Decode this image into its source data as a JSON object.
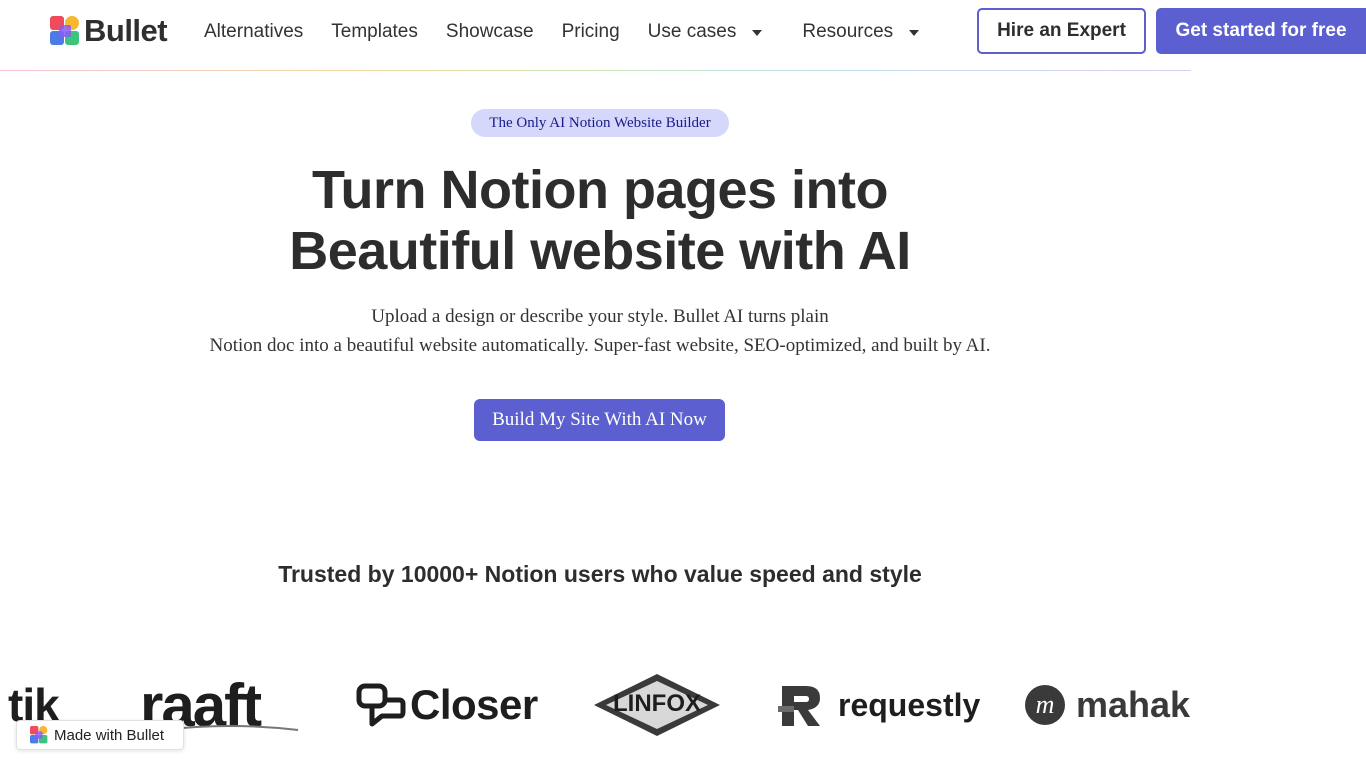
{
  "header": {
    "brand": "Bullet",
    "nav": [
      {
        "label": "Alternatives",
        "dropdown": false
      },
      {
        "label": "Templates",
        "dropdown": false
      },
      {
        "label": "Showcase",
        "dropdown": false
      },
      {
        "label": "Pricing",
        "dropdown": false
      },
      {
        "label": "Use cases",
        "dropdown": true
      },
      {
        "label": "Resources",
        "dropdown": true
      }
    ],
    "hire_label": "Hire an Expert",
    "get_started_label": "Get started for free"
  },
  "hero": {
    "badge": "The Only AI Notion Website Builder",
    "title_line1": "Turn Notion pages into",
    "title_line2": "Beautiful website with AI",
    "subtitle_line1": "Upload a design or describe your style. Bullet AI turns plain",
    "subtitle_line2": "Notion doc into a beautiful website automatically. Super-fast website, SEO-optimized, and built by AI.",
    "cta_label": "Build My Site With AI Now"
  },
  "trusted": {
    "text": "Trusted by 10000+ Notion users who value speed and style",
    "logos": [
      "tik",
      "raaft",
      "Closer",
      "LINFOX",
      "requestly",
      "mahaka"
    ]
  },
  "made_with": {
    "label": "Made with Bullet"
  },
  "colors": {
    "primary": "#5b5fcf",
    "badge_bg": "#d5d8fb",
    "badge_text": "#1a1a8a",
    "heading": "#2d2d2d",
    "brand_red": "#ef4b5a",
    "brand_yellow": "#f5b82e",
    "brand_green": "#3cc47c",
    "brand_blue": "#4a7be8",
    "brand_purple": "#8a5cf0"
  }
}
